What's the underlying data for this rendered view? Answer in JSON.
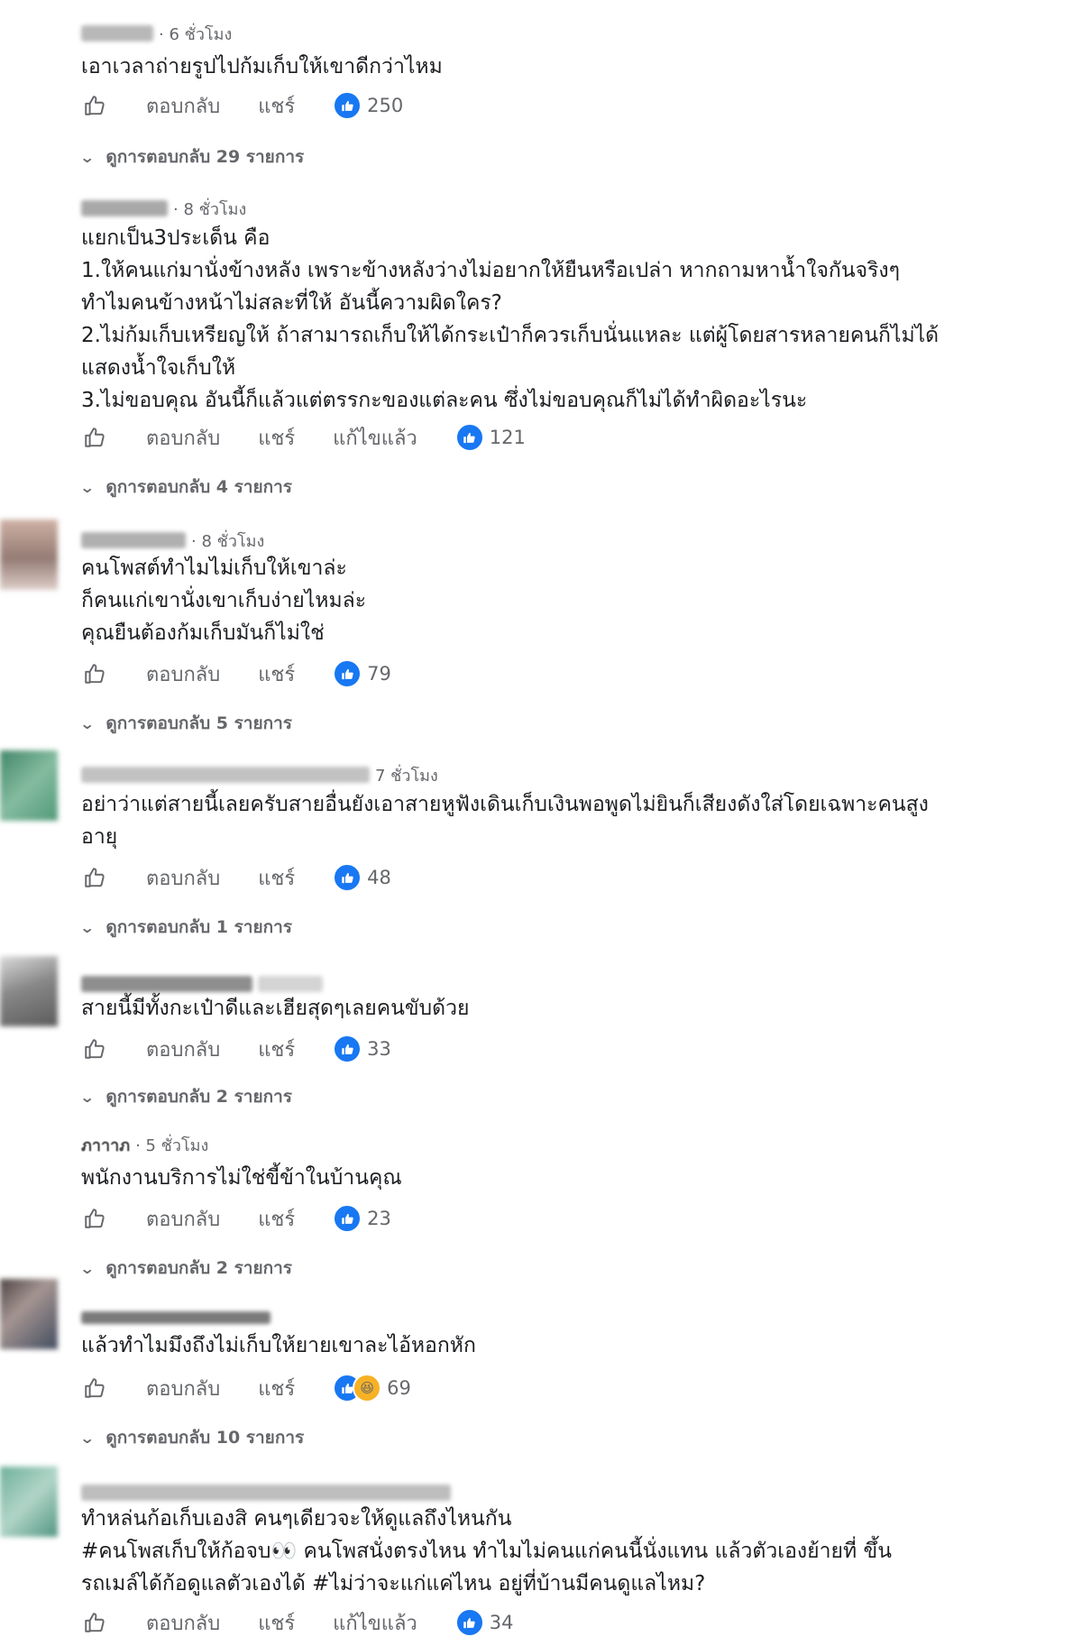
{
  "labels": {
    "reply": "ตอบกลับ",
    "share": "แชร์",
    "edited": "แก้ไขแล้ว"
  },
  "colors": {
    "like_blue": "#1877f2",
    "text": "#1c1e21",
    "muted": "#65676b"
  },
  "comments": [
    {
      "time": "· 6 ชั่วโมง",
      "text": "เอาเวลาถ่ายรูปไปก้มเก็บให้เขาดีกว่าไหม",
      "reactions": "250",
      "view_replies": "ดูการตอบกลับ 29 รายการ"
    },
    {
      "time": "· 8 ชั่วโมง",
      "text": "แยกเป็น3ประเด็น คือ\n1.ให้คนแก่มานั่งข้างหลัง เพราะข้างหลังว่างไม่อยากให้ยืนหรือเปล่า หากถามหาน้ำใจกันจริงๆ\nทำไมคนข้างหน้าไม่สละที่ให้ อันนี้ความผิดใคร?\n2.ไม่ก้มเก็บเหรียญให้ ถ้าสามารถเก็บให้ได้กระเป๋าก็ควรเก็บนั่นแหละ แต่ผู้โดยสารหลายคนก็ไม่ได้\nแสดงน้ำใจเก็บให้\n3.ไม่ขอบคุณ อันนี้ก็แล้วแต่ตรรกะของแต่ละคน ซึ่งไม่ขอบคุณก็ไม่ได้ทำผิดอะไรนะ",
      "reactions": "121",
      "view_replies": "ดูการตอบกลับ 4 รายการ"
    },
    {
      "time": "· 8 ชั่วโมง",
      "text": "คนโพสต์ทำไมไม่เก็บให้เขาล่ะ\nก็คนแก่เขานั่งเขาเก็บง่ายไหมล่ะ\nคุณยืนต้องก้มเก็บมันก็ไม่ใช่",
      "reactions": "79",
      "view_replies": "ดูการตอบกลับ 5 รายการ"
    },
    {
      "time": "7 ชั่วโมง",
      "text": "อย่าว่าแต่สายนี้เลยครับสายอื่นยังเอาสายหูฟังเดินเก็บเงินพอพูดไม่ยินก็เสียงดังใส่โดยเฉพาะคนสูง\nอายุ",
      "reactions": "48",
      "view_replies": "ดูการตอบกลับ 1 รายการ"
    },
    {
      "time": "",
      "text": "สายนี้มีทั้งกะเป๋าดีและเฮียสุดๆเลยคนขับด้วย",
      "reactions": "33",
      "view_replies": "ดูการตอบกลับ 2 รายการ"
    },
    {
      "name": "ภาาาภ",
      "time": "· 5 ชั่วโมง",
      "text": "พนักงานบริการไม่ใช่ขี้ข้าในบ้านคุณ",
      "reactions": "23",
      "view_replies": "ดูการตอบกลับ 2 รายการ"
    },
    {
      "time": "",
      "text": "แล้วทำไมมึงถึงไม่เก็บให้ยายเขาละไอ้หอกหัก",
      "reactions": "69",
      "view_replies": "ดูการตอบกลับ 10 รายการ"
    },
    {
      "time": "",
      "text": "ทำหล่นก้อเก็บเองสิ คนๆเดียวจะให้ดูแลถึงไหนกัน\n#คนโพสเก็บให้ก้อจบ👀 คนโพสนั่งตรงไหน ทำไมไม่คนแก่คนนี้นั่งแทน แล้วตัวเองย้ายที่ ขึ้น\nรถเมล์ได้ก้อดูแลตัวเองได้ #ไม่ว่าจะแก่แค่ไหน อยู่ที่บ้านมีคนดูแลไหม?",
      "reactions": "34"
    }
  ]
}
